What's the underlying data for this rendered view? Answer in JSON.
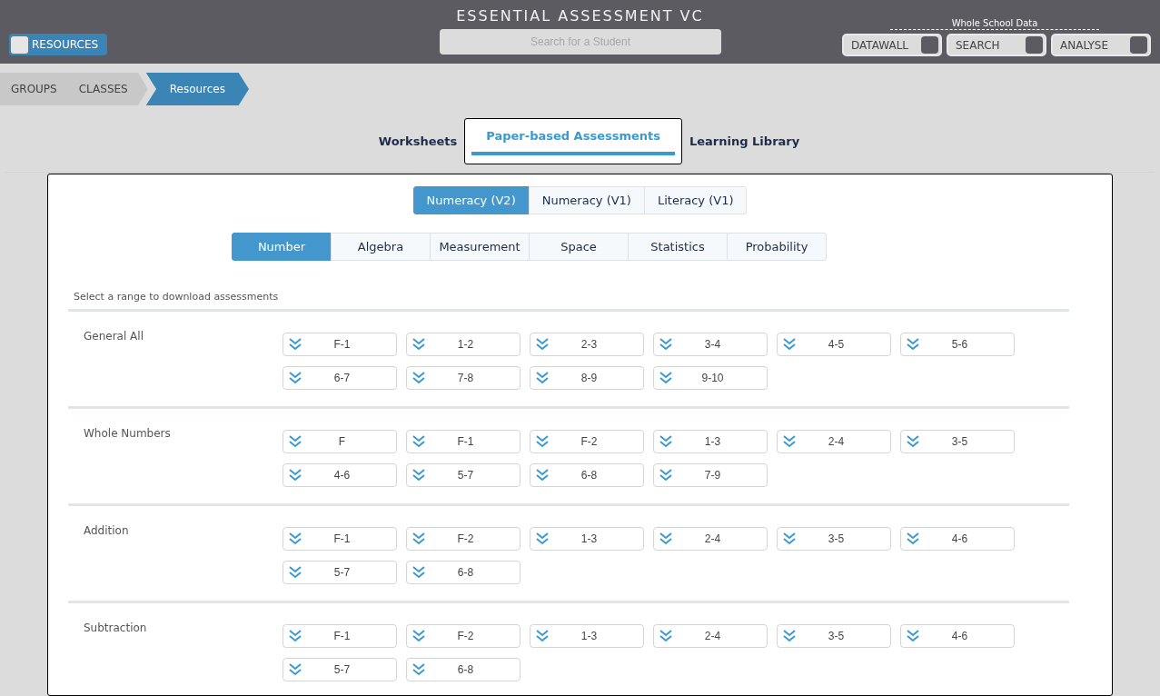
{
  "header": {
    "title": "ESSENTIAL ASSESSMENT VC",
    "resources_button": "RESOURCES",
    "search": {
      "placeholder": "Search for a Student"
    },
    "group_label": "Whole School Data",
    "nav_buttons": [
      "DATAWALL",
      "SEARCH",
      "ANALYSE"
    ]
  },
  "breadcrumbs": [
    {
      "label": "GROUPS",
      "selected": false
    },
    {
      "label": "CLASSES",
      "selected": false
    },
    {
      "label": "Resources",
      "selected": true
    }
  ],
  "tabs": [
    {
      "label": "Worksheets",
      "selected": false
    },
    {
      "label": "Paper-based Assessments",
      "selected": true
    },
    {
      "label": "Learning Library",
      "selected": false
    }
  ],
  "versions": [
    {
      "label": "Numeracy (V2)",
      "selected": true
    },
    {
      "label": "Numeracy (V1)",
      "selected": false
    },
    {
      "label": "Literacy (V1)",
      "selected": false
    }
  ],
  "strands": [
    {
      "label": "Number",
      "selected": true
    },
    {
      "label": "Algebra",
      "selected": false
    },
    {
      "label": "Measurement",
      "selected": false
    },
    {
      "label": "Space",
      "selected": false
    },
    {
      "label": "Statistics",
      "selected": false
    },
    {
      "label": "Probability",
      "selected": false
    }
  ],
  "instruction": "Select a range to download assessments",
  "sections": [
    {
      "name": "General All",
      "ranges": [
        "F-1",
        "1-2",
        "2-3",
        "3-4",
        "4-5",
        "5-6",
        "6-7",
        "7-8",
        "8-9",
        "9-10"
      ]
    },
    {
      "name": "Whole Numbers",
      "ranges": [
        "F",
        "F-1",
        "F-2",
        "1-3",
        "2-4",
        "3-5",
        "4-6",
        "5-7",
        "6-8",
        "7-9"
      ]
    },
    {
      "name": "Addition",
      "ranges": [
        "F-1",
        "F-2",
        "1-3",
        "2-4",
        "3-5",
        "4-6",
        "5-7",
        "6-8"
      ]
    },
    {
      "name": "Subtraction",
      "ranges": [
        "F-1",
        "F-2",
        "1-3",
        "2-4",
        "3-5",
        "4-6",
        "5-7",
        "6-8"
      ]
    }
  ]
}
